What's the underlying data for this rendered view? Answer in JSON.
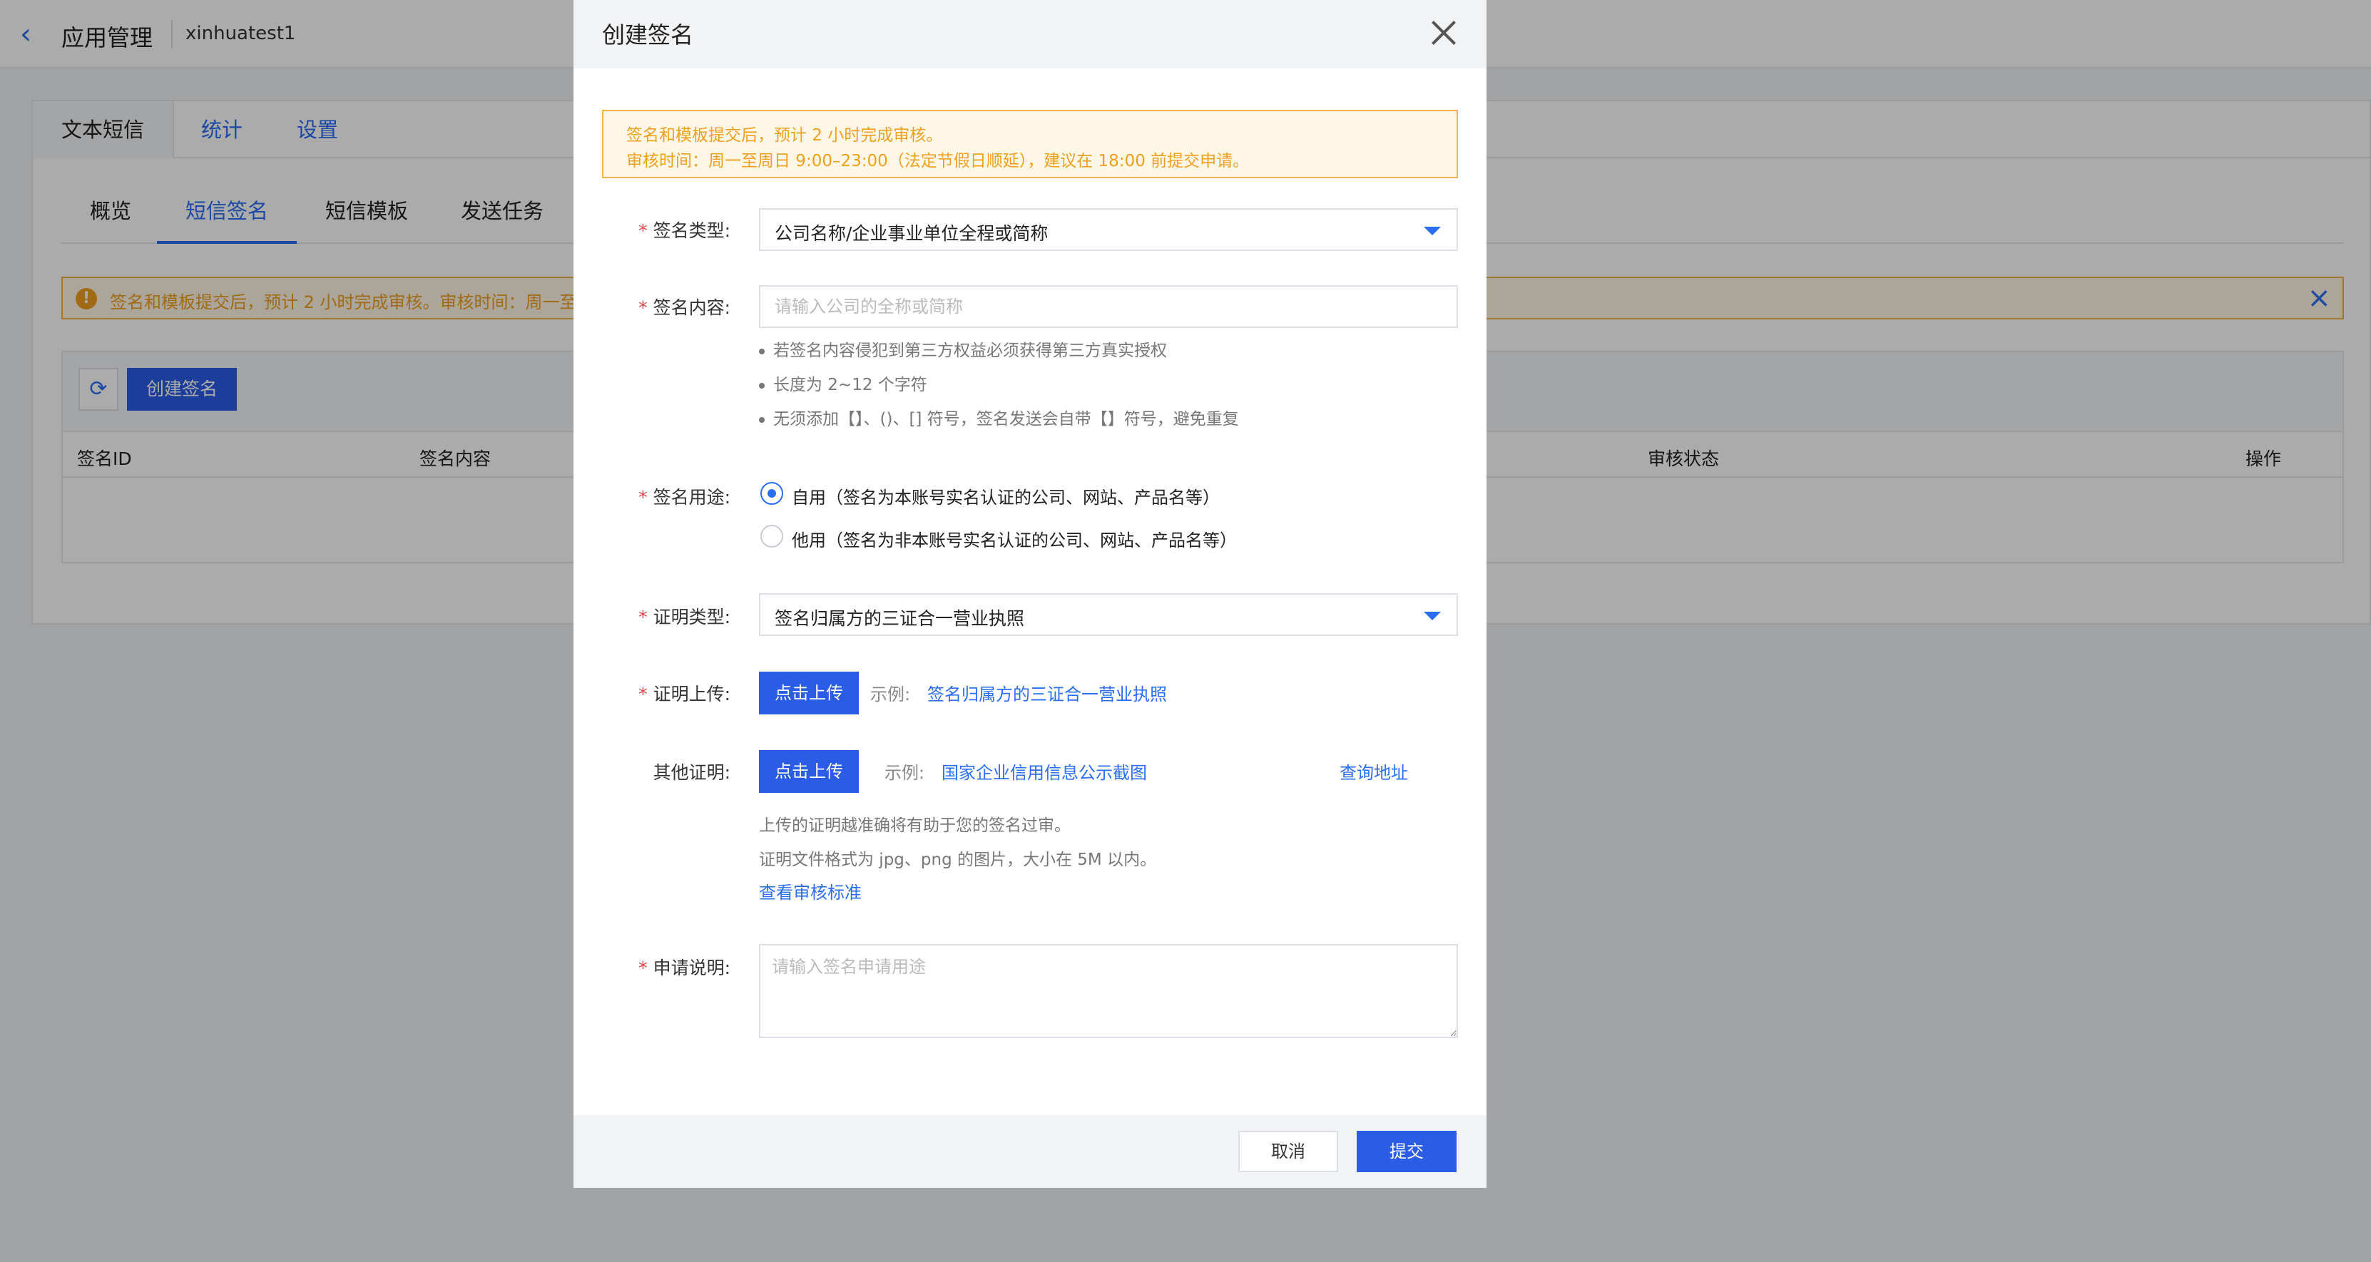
{
  "background": {
    "topbar": {
      "back_icon": "‹",
      "title": "应用管理",
      "app_name": "xinhuatest1"
    },
    "tabs_primary": [
      "文本短信",
      "统计",
      "设置"
    ],
    "tabs_secondary": [
      "概览",
      "短信签名",
      "短信模板",
      "发送任务"
    ],
    "notice": {
      "text": "签名和模板提交后，预计 2 小时完成审核。审核时间：周一至"
    },
    "toolbar": {
      "create_label": "创建签名"
    },
    "table_headers": [
      "签名ID",
      "签名内容",
      "审核状态",
      "操作"
    ]
  },
  "modal": {
    "title": "创建签名",
    "alert": {
      "line1": "签名和模板提交后，预计 2 小时完成审核。",
      "line2": "审核时间：周一至周日 9:00–23:00（法定节假日顺延），建议在 18:00 前提交申请。"
    },
    "sign_type": {
      "label": "签名类型:",
      "value": "公司名称/企业事业单位全程或简称"
    },
    "sign_content": {
      "label": "签名内容:",
      "placeholder": "请输入公司的全称或简称",
      "hints": [
        "若签名内容侵犯到第三方权益必须获得第三方真实授权",
        "长度为 2~12 个字符",
        "无须添加【】、()、[] 符号，签名发送会自带【】符号，避免重复"
      ]
    },
    "sign_usage": {
      "label": "签名用途:",
      "options": [
        "自用（签名为本账号实名认证的公司、网站、产品名等）",
        "他用（签名为非本账号实名认证的公司、网站、产品名等）"
      ]
    },
    "cert_type": {
      "label": "证明类型:",
      "value": "签名归属方的三证合一营业执照"
    },
    "cert_upload": {
      "label": "证明上传:",
      "button": "点击上传",
      "example_label": "示例:",
      "example_link": "签名归属方的三证合一营业执照"
    },
    "other_cert": {
      "label": "其他证明:",
      "button": "点击上传",
      "example_label": "示例:",
      "example_link": "国家企业信用信息公示截图",
      "query_link": "查询地址",
      "desc1": "上传的证明越准确将有助于您的签名过审。",
      "desc2": "证明文件格式为 jpg、png 的图片，大小在 5M 以内。",
      "standard_link": "查看审核标准"
    },
    "application_note": {
      "label": "申请说明:",
      "placeholder": "请输入签名申请用途"
    },
    "footer": {
      "cancel": "取消",
      "submit": "提交"
    }
  },
  "colors": {
    "primary": "#2b5ce6",
    "link": "#2b6ef2",
    "warning": "#f0a020",
    "required": "#e54545"
  }
}
